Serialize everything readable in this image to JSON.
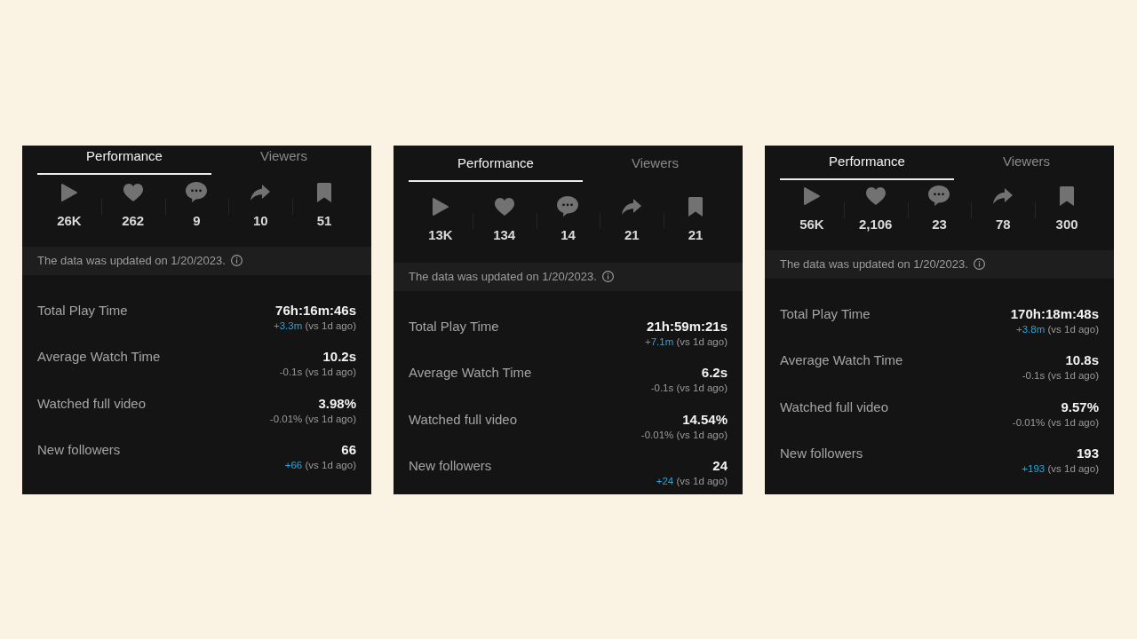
{
  "panels": [
    {
      "tabs": [
        {
          "label": "Performance",
          "selected": true
        },
        {
          "label": "Viewers",
          "selected": false
        }
      ],
      "stats": [
        {
          "kind": "play",
          "value": "26K"
        },
        {
          "kind": "like",
          "value": "262"
        },
        {
          "kind": "comment",
          "value": "9"
        },
        {
          "kind": "share",
          "value": "10"
        },
        {
          "kind": "save",
          "value": "51"
        }
      ],
      "notice": "The data was updated on 1/20/2023.",
      "metrics": [
        {
          "label": "Total Play Time",
          "value": "76h:16m:46s",
          "delta": "+3.3m",
          "increase": true,
          "comparison": "(vs 1d ago)"
        },
        {
          "label": "Average Watch Time",
          "value": "10.2s",
          "delta": "-0.1s",
          "increase": false,
          "comparison": "(vs 1d ago)"
        },
        {
          "label": "Watched full video",
          "value": "3.98%",
          "delta": "-0.01%",
          "increase": false,
          "comparison": "(vs 1d ago)"
        },
        {
          "label": "New followers",
          "value": "66",
          "delta": "+66",
          "increase": true,
          "comparison": "(vs 1d ago)"
        }
      ]
    },
    {
      "tabs": [
        {
          "label": "Performance",
          "selected": true
        },
        {
          "label": "Viewers",
          "selected": false
        }
      ],
      "stats": [
        {
          "kind": "play",
          "value": "13K"
        },
        {
          "kind": "like",
          "value": "134"
        },
        {
          "kind": "comment",
          "value": "14"
        },
        {
          "kind": "share",
          "value": "21"
        },
        {
          "kind": "save",
          "value": "21"
        }
      ],
      "notice": "The data was updated on 1/20/2023.",
      "metrics": [
        {
          "label": "Total Play Time",
          "value": "21h:59m:21s",
          "delta": "+7.1m",
          "increase": true,
          "comparison": "(vs 1d ago)"
        },
        {
          "label": "Average Watch Time",
          "value": "6.2s",
          "delta": "-0.1s",
          "increase": false,
          "comparison": "(vs 1d ago)"
        },
        {
          "label": "Watched full video",
          "value": "14.54%",
          "delta": "-0.01%",
          "increase": false,
          "comparison": "(vs 1d ago)"
        },
        {
          "label": "New followers",
          "value": "24",
          "delta": "+24",
          "increase": true,
          "comparison": "(vs 1d ago)"
        }
      ]
    },
    {
      "tabs": [
        {
          "label": "Performance",
          "selected": true
        },
        {
          "label": "Viewers",
          "selected": false
        }
      ],
      "stats": [
        {
          "kind": "play",
          "value": "56K"
        },
        {
          "kind": "like",
          "value": "2,106"
        },
        {
          "kind": "comment",
          "value": "23"
        },
        {
          "kind": "share",
          "value": "78"
        },
        {
          "kind": "save",
          "value": "300"
        }
      ],
      "notice": "The data was updated on 1/20/2023.",
      "metrics": [
        {
          "label": "Total Play Time",
          "value": "170h:18m:48s",
          "delta": "+3.8m",
          "increase": true,
          "comparison": "(vs 1d ago)"
        },
        {
          "label": "Average Watch Time",
          "value": "10.8s",
          "delta": "-0.1s",
          "increase": false,
          "comparison": "(vs 1d ago)"
        },
        {
          "label": "Watched full video",
          "value": "9.57%",
          "delta": "-0.01%",
          "increase": false,
          "comparison": "(vs 1d ago)"
        },
        {
          "label": "New followers",
          "value": "193",
          "delta": "+193",
          "increase": true,
          "comparison": "(vs 1d ago)"
        }
      ]
    }
  ]
}
